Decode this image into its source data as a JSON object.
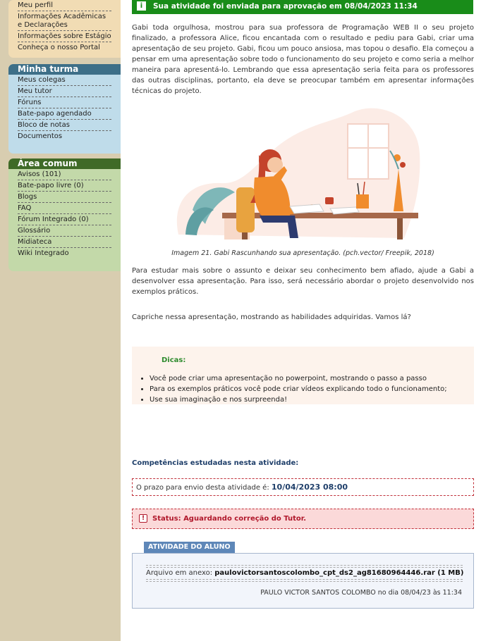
{
  "sidebar": {
    "perfil_items": [
      "Meu perfil",
      "Informações Acadêmicas e Declarações",
      "Informações sobre Estágio",
      "Conheça o nosso Portal"
    ],
    "minha_turma": {
      "title": "Minha turma",
      "items": [
        "Meus colegas",
        "Meu tutor",
        "Fóruns",
        "Bate-papo agendado",
        "Bloco de notas",
        "Documentos"
      ]
    },
    "area_comum": {
      "title": "Área comum",
      "items": [
        "Avisos (101)",
        "Bate-papo livre (0)",
        "Blogs",
        "FAQ",
        "Fórum Integrado (0)",
        "Glossário",
        "Midiateca",
        "Wiki Integrado"
      ]
    }
  },
  "main": {
    "sent_banner": "Sua atividade foi enviada para aprovação em 08/04/2023 11:34",
    "paragraph1": "Gabi toda orgulhosa, mostrou para sua professora de Programação WEB II o seu projeto finalizado, a professora Alice, ficou encantada com o resultado e pediu para Gabi, criar uma apresentação de seu projeto.  Gabi, ficou um pouco ansiosa, mas topou o desafio. Ela começou a pensar em uma apresentação sobre todo o funcionamento do seu projeto e como seria a melhor maneira para apresentá-lo. Lembrando que essa apresentação seria feita para os professores das outras disciplinas, portanto, ela deve se preocupar também em apresentar informações técnicas do projeto.",
    "image_caption": "Imagem 21. Gabi Rascunhando sua apresentação. (pch.vector/ Freepik, 2018)",
    "paragraph2": "Para estudar mais sobre o assunto e deixar seu conhecimento bem afiado, ajude a Gabi a desenvolver essa apresentação. Para isso, será necessário abordar o projeto desenvolvido nos exemplos práticos.",
    "paragraph3": "Capriche nessa apresentação, mostrando as habilidades adquiridas. Vamos lá?",
    "dicas": {
      "title": "Dicas:",
      "items": [
        "Você pode criar uma apresentação no powerpoint, mostrando o passo a passo",
        "Para os exemplos práticos você pode criar vídeos explicando todo o funcionamento;",
        "Use sua imaginação e nos surpreenda!"
      ]
    },
    "competencias_title": "Competências estudadas nesta atividade:",
    "prazo_label": "O prazo para envio desta atividade é:",
    "prazo_value": "10/04/2023 08:00",
    "status_text": "Status: Aguardando correção do Tutor.",
    "atividade_tab": "ATIVIDADE DO ALUNO",
    "arquivo_label": "Arquivo em anexo:",
    "arquivo_name": "paulovictorsantoscolombo_cpt_ds2_ag81680964446.rar (1 MB)",
    "autor_line": "PAULO VICTOR SANTOS COLOMBO no dia 08/04/23 às 11:34"
  },
  "colors": {
    "banner_green": "#198c19",
    "turma_header": "#3d6f88",
    "comum_header": "#3f6a27",
    "status_red": "#b0182b",
    "link_blue": "#1f3f6a"
  }
}
